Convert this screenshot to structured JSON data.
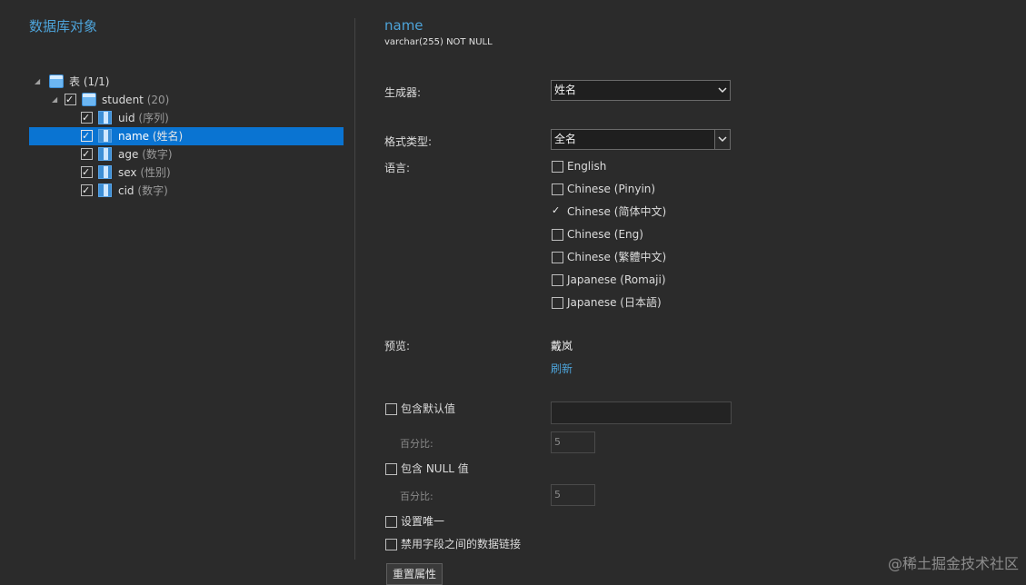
{
  "left_panel": {
    "title": "数据库对象",
    "tree": {
      "root": {
        "label": "表 (1/1)",
        "expanded": true
      },
      "table": {
        "name": "student",
        "count": "(20)",
        "checked": true
      },
      "columns": [
        {
          "name": "uid",
          "type": "(序列)",
          "checked": true,
          "selected": false
        },
        {
          "name": "name",
          "type": "(姓名)",
          "checked": true,
          "selected": true
        },
        {
          "name": "age",
          "type": "(数字)",
          "checked": true,
          "selected": false
        },
        {
          "name": "sex",
          "type": "(性别)",
          "checked": true,
          "selected": false
        },
        {
          "name": "cid",
          "type": "(数字)",
          "checked": true,
          "selected": false
        }
      ]
    }
  },
  "right_panel": {
    "field_name": "name",
    "field_type": "varchar(255) NOT NULL",
    "generator_label": "生成器:",
    "generator_value": "姓名",
    "format_label": "格式类型:",
    "format_value": "全名",
    "language_label": "语言:",
    "languages": [
      {
        "label": "English",
        "checked": false
      },
      {
        "label": "Chinese (Pinyin)",
        "checked": false
      },
      {
        "label": "Chinese (简体中文)",
        "checked": true
      },
      {
        "label": "Chinese (Eng)",
        "checked": false
      },
      {
        "label": "Chinese (繁體中文)",
        "checked": false
      },
      {
        "label": "Japanese (Romaji)",
        "checked": false
      },
      {
        "label": "Japanese (日本語)",
        "checked": false
      }
    ],
    "preview_label": "预览:",
    "preview_value": "戴岚",
    "refresh_label": "刷新",
    "include_default_label": "包含默认值",
    "include_default_checked": false,
    "default_value": "",
    "percent_label_1": "百分比:",
    "percent_value_1": "5",
    "include_null_label": "包含 NULL 值",
    "include_null_checked": false,
    "percent_label_2": "百分比:",
    "percent_value_2": "5",
    "unique_label": "设置唯一",
    "unique_checked": false,
    "disable_link_label": "禁用字段之间的数据链接",
    "disable_link_checked": false,
    "reset_button": "重置属性"
  },
  "watermark": "@稀土掘金技术社区",
  "colors": {
    "background": "#2b2b2b",
    "accent": "#4da3d9",
    "selection": "#0a74d2"
  }
}
